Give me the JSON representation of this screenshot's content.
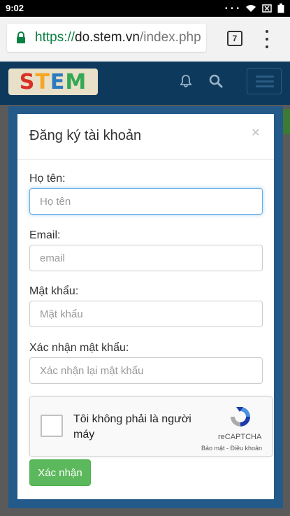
{
  "status_bar": {
    "time": "9:02"
  },
  "browser": {
    "url_scheme": "https://",
    "url_host": "do.stem.vn",
    "url_path": "/index.php",
    "tab_count": "7"
  },
  "site": {
    "logo_text": [
      "S",
      "T",
      "E",
      "M"
    ]
  },
  "modal": {
    "title": "Đăng ký tài khoản",
    "close_label": "×",
    "fields": [
      {
        "label": "Họ tên:",
        "placeholder": "Họ tên",
        "value": ""
      },
      {
        "label": "Email:",
        "placeholder": "email",
        "value": ""
      },
      {
        "label": "Mật khẩu:",
        "placeholder": "Mật khẩu",
        "value": ""
      },
      {
        "label": "Xác nhận mật khẩu:",
        "placeholder": "Xác nhận lại mật khẩu",
        "value": ""
      }
    ],
    "recaptcha": {
      "label": "Tôi không phải là người máy",
      "brand": "reCAPTCHA",
      "links": "Bảo mật - Điều khoản"
    },
    "submit_label": "Xác nhận"
  },
  "colors": {
    "header_bg": "#0d3a5c",
    "modal_frame": "#245a8a",
    "submit_bg": "#5cb85c",
    "url_scheme": "#0b8043",
    "focus_border": "#66afe9"
  }
}
